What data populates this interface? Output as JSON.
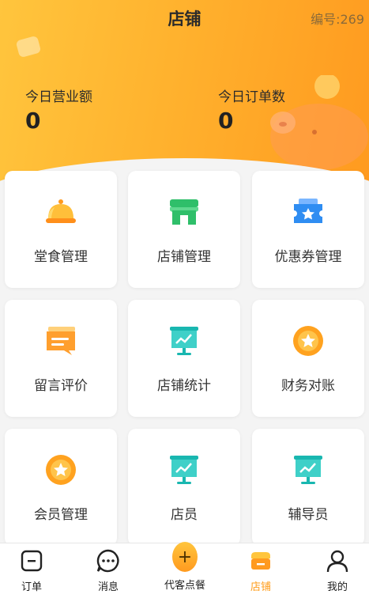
{
  "header": {
    "title": "店铺",
    "shop_number": "编号:269",
    "revenue_label": "今日营业额",
    "revenue_value": "0",
    "orders_label": "今日订单数",
    "orders_value": "0"
  },
  "tiles": [
    {
      "label": "堂食管理",
      "icon": "dine-in-cloche-icon"
    },
    {
      "label": "店铺管理",
      "icon": "shop-icon"
    },
    {
      "label": "优惠券管理",
      "icon": "coupon-ticket-icon"
    },
    {
      "label": "留言评价",
      "icon": "message-board-icon"
    },
    {
      "label": "店铺统计",
      "icon": "statistics-board-icon"
    },
    {
      "label": "财务对账",
      "icon": "coin-icon"
    },
    {
      "label": "会员管理",
      "icon": "member-coin-icon"
    },
    {
      "label": "店员",
      "icon": "staff-board-icon"
    },
    {
      "label": "辅导员",
      "icon": "counselor-board-icon"
    }
  ],
  "tabbar": {
    "items": [
      {
        "label": "订单",
        "icon": "order-icon"
      },
      {
        "label": "消息",
        "icon": "message-icon"
      },
      {
        "label": "代客点餐",
        "icon": "plus-icon"
      },
      {
        "label": "店铺",
        "icon": "shop-tab-icon"
      },
      {
        "label": "我的",
        "icon": "user-icon"
      }
    ],
    "active": "店铺"
  },
  "colors": {
    "accent": "#ffa825",
    "header_start": "#ffc53d",
    "header_end": "#ff9a1f",
    "tile_bg": "#ffffff",
    "page_bg": "#f4f4f4"
  }
}
